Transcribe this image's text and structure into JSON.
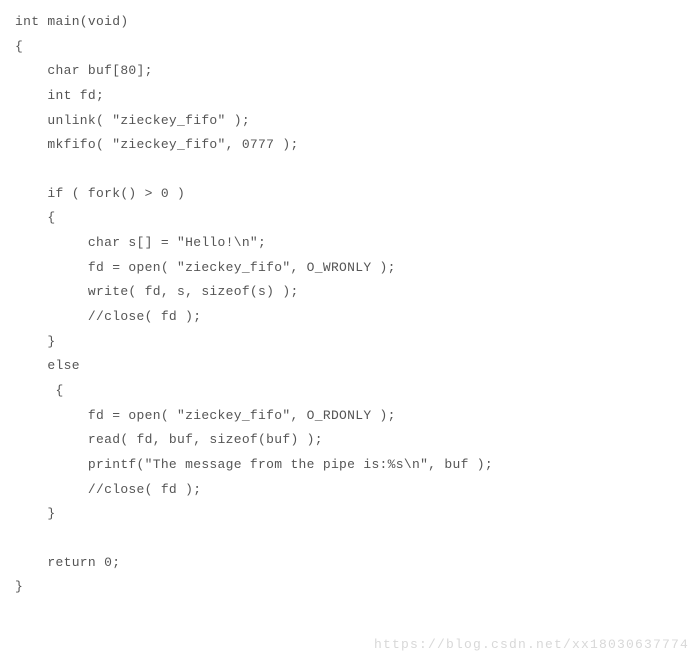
{
  "code": {
    "lines": [
      "int main(void)",
      "{",
      "    char buf[80];",
      "    int fd;",
      "    unlink( \"zieckey_fifo\" );",
      "    mkfifo( \"zieckey_fifo\", 0777 );",
      "",
      "    if ( fork() > 0 )",
      "    {",
      "         char s[] = \"Hello!\\n\";",
      "         fd = open( \"zieckey_fifo\", O_WRONLY );",
      "         write( fd, s, sizeof(s) );",
      "         //close( fd );",
      "    }",
      "    else",
      "     {",
      "         fd = open( \"zieckey_fifo\", O_RDONLY );",
      "         read( fd, buf, sizeof(buf) );",
      "         printf(\"The message from the pipe is:%s\\n\", buf );",
      "         //close( fd );",
      "    }",
      "",
      "    return 0;",
      "}"
    ]
  },
  "watermark": "https://blog.csdn.net/xx18030637774"
}
